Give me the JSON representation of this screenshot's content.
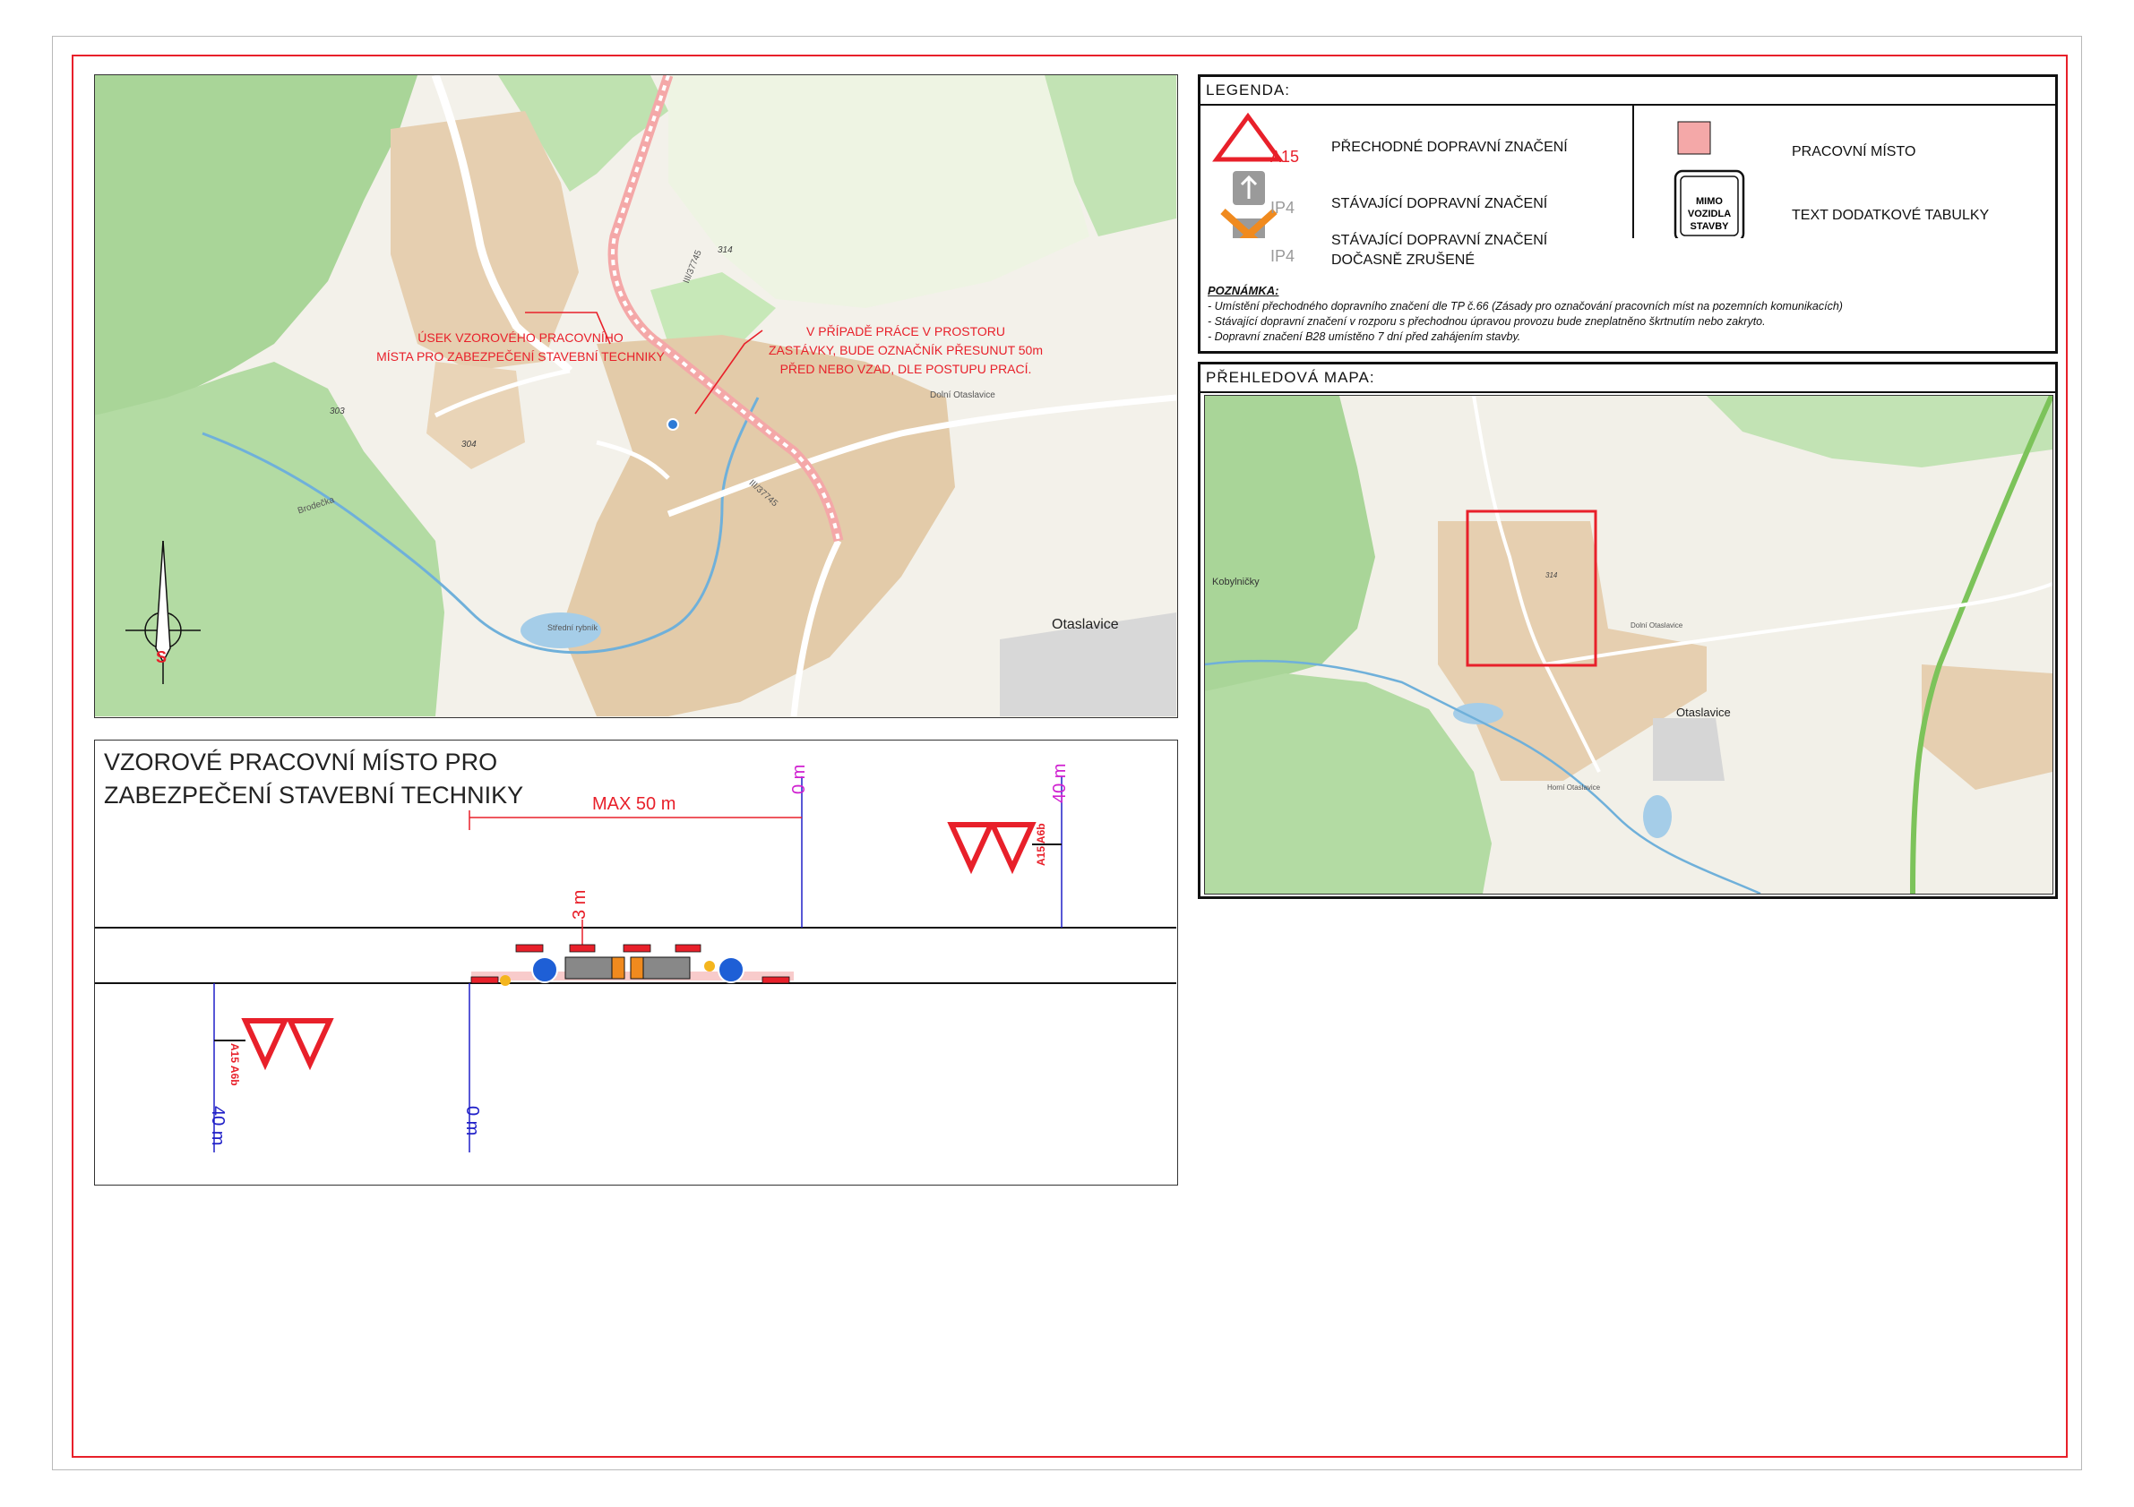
{
  "main_map": {
    "note_section": "ÚSEK VZOROVÉHO PRACOVNÍHO\nMÍSTA PRO ZABEZPEČENÍ STAVEBNÍ TECHNIKY",
    "note_bus_stop": "V PŘÍPADĚ PRÁCE V PROSTORU\nZASTÁVKY, BUDE OZNAČNÍK PŘESUNUT 50m\nPŘED NEBO VZAD, DLE POSTUPU PRACÍ.",
    "town_label": "Otaslavice",
    "village_label": "Dolní Otaslavice",
    "road_label_north": "III/37745",
    "road_label_south": "III/37745",
    "elev_314": "314",
    "elev_303": "303",
    "elev_304": "304",
    "stream_label": "Brodečka",
    "pond_label": "Střední rybník",
    "north_arrow_letter": "S"
  },
  "diagram": {
    "title": "VZOROVÉ PRACOVNÍ MÍSTO PRO ZABEZPEČENÍ STAVEBNÍ TECHNIKY",
    "max_label": "MAX 50 m",
    "zero_top": "0 m",
    "forty_top": "40 m",
    "three_m": "3 m",
    "zero_bottom": "0 m",
    "forty_bottom": "40 m",
    "sign_top_a15": "A15",
    "sign_top_a6b": "A6b",
    "sign_bottom_a15": "A15",
    "sign_bottom_a6b": "A6b"
  },
  "legend": {
    "header": "LEGENDA:",
    "items": [
      {
        "code": "A15",
        "text": "PŘECHODNÉ DOPRAVNÍ ZNAČENÍ"
      },
      {
        "code": "IP4",
        "text": "STÁVAJÍCÍ DOPRAVNÍ ZNAČENÍ"
      },
      {
        "code": "IP4",
        "text": "STÁVAJÍCÍ DOPRAVNÍ ZNAČENÍ\nDOČASNĚ ZRUŠENÉ"
      },
      {
        "text": "PRACOVNÍ MÍSTO"
      },
      {
        "text": "TEXT DODATKOVÉ TABULKY"
      }
    ],
    "plate_text": "MIMO\nVOZIDLA\nSTAVBY",
    "note_title": "POZNÁMKA:",
    "notes": [
      "- Umístění přechodného dopravního značení dle TP č.66 (Zásady pro označování pracovních míst na pozemních komunikacích)",
      "- Stávající dopravní značení v rozporu s přechodnou úpravou provozu bude zneplatněno škrtnutím nebo zakryto.",
      "- Dopravní značení B28 umístěno 7 dní před zahájením stavby."
    ]
  },
  "overview": {
    "header": "PŘEHLEDOVÁ MAPA:",
    "labels": {
      "kobylnicky": "Kobylničky",
      "otaslavice": "Otaslavice",
      "dolni": "Dolní Otaslavice",
      "horni": "Horní Otaslavice",
      "elev": "314"
    }
  },
  "colors": {
    "red": "#e8202a",
    "work_zone": "#f4a8a8",
    "forest": "#a9d598",
    "built": "#e6cfb0",
    "dim_blue": "#2020c8",
    "dim_magenta": "#d020d0"
  }
}
